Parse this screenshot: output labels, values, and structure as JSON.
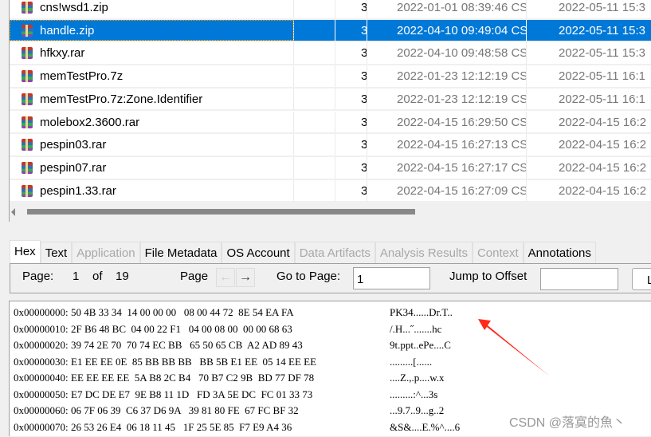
{
  "file_table": {
    "selected_index": 1,
    "rows": [
      {
        "name": "cns!wsd1.zip",
        "flag": "3",
        "c_time": "2022-01-01 08:39:46 CST",
        "m_time": "2022-05-11 15:3"
      },
      {
        "name": "handle.zip",
        "flag": "3",
        "c_time": "2022-04-10 09:49:04 CST",
        "m_time": "2022-05-11 15:3"
      },
      {
        "name": "hfkxy.rar",
        "flag": "3",
        "c_time": "2022-04-10 09:48:58 CST",
        "m_time": "2022-05-11 15:3"
      },
      {
        "name": "memTestPro.7z",
        "flag": "3",
        "c_time": "2022-01-23 12:12:19 CST",
        "m_time": "2022-05-11 16:1"
      },
      {
        "name": "memTestPro.7z:Zone.Identifier",
        "flag": "3",
        "c_time": "2022-01-23 12:12:19 CST",
        "m_time": "2022-05-11 16:1"
      },
      {
        "name": "molebox2.3600.rar",
        "flag": "3",
        "c_time": "2022-04-15 16:29:50 CST",
        "m_time": "2022-04-15 16:2"
      },
      {
        "name": "pespin03.rar",
        "flag": "3",
        "c_time": "2022-04-15 16:27:13 CST",
        "m_time": "2022-04-15 16:2"
      },
      {
        "name": "pespin07.rar",
        "flag": "3",
        "c_time": "2022-04-15 16:27:17 CST",
        "m_time": "2022-04-15 16:2"
      },
      {
        "name": "pespin1.33.rar",
        "flag": "3",
        "c_time": "2022-04-15 16:27:09 CST",
        "m_time": "2022-04-15 16:2"
      }
    ]
  },
  "tabs": [
    {
      "label": "Hex",
      "active": true,
      "enabled": true
    },
    {
      "label": "Text",
      "enabled": true
    },
    {
      "label": "Application",
      "enabled": false
    },
    {
      "label": "File Metadata",
      "enabled": true
    },
    {
      "label": "OS Account",
      "enabled": true
    },
    {
      "label": "Data Artifacts",
      "enabled": false
    },
    {
      "label": "Analysis Results",
      "enabled": false
    },
    {
      "label": "Context",
      "enabled": false
    },
    {
      "label": "Annotations",
      "enabled": true
    }
  ],
  "toolbar": {
    "page_label": "Page:",
    "page_current": "1",
    "of_label": "of",
    "page_total": "19",
    "page_nav_label": "Page",
    "goto_label": "Go to Page:",
    "goto_value": "1",
    "jump_label": "Jump to Offset",
    "jump_value": "",
    "launch_label": "L"
  },
  "hex": [
    {
      "off": "0x00000000:",
      "hex": "50 4B 33 34  14 00 00 00   08 00 44 72  8E 54 EA FA",
      "ascii": "PK34......Dr.T.."
    },
    {
      "off": "0x00000010:",
      "hex": "2F B6 48 BC  04 00 22 F1   04 00 08 00  00 00 68 63",
      "ascii": "/.H...˝.......hc"
    },
    {
      "off": "0x00000020:",
      "hex": "39 74 2E 70  70 74 EC BB   65 50 65 CB  A2 AD 89 43",
      "ascii": "9t.ppt..ePe....C"
    },
    {
      "off": "0x00000030:",
      "hex": "E1 EE EE 0E  85 BB BB BB   BB 5B E1 EE  05 14 EE EE",
      "ascii": ".........[......"
    },
    {
      "off": "0x00000040:",
      "hex": "EE EE EE EE  5A B8 2C B4   70 B7 C2 9B  BD 77 DF 78",
      "ascii": "....Z.,.p....w.x"
    },
    {
      "off": "0x00000050:",
      "hex": "E7 DC DE E7  9E B8 11 1D   FD 3A 5E DC  FC 01 33 73",
      "ascii": ".........:^...3s"
    },
    {
      "off": "0x00000060:",
      "hex": "06 7F 06 39  C6 37 D6 9A   39 81 80 FE  67 FC BF 32",
      "ascii": "...9.7..9...g..2"
    },
    {
      "off": "0x00000070:",
      "hex": "26 53 26 E4  06 18 11 45   1F 25 5E 85  F7 E9 A4 36",
      "ascii": "&S&....E.%^....6"
    }
  ],
  "watermark": "CSDN @落寞的魚丶",
  "colors": {
    "selection": "#0078d7",
    "arrow": "#ff2a1a"
  }
}
